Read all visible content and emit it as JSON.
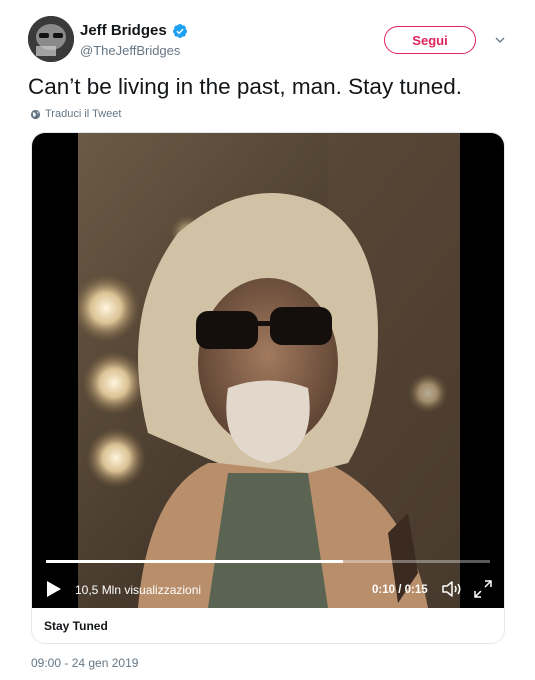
{
  "author": {
    "name": "Jeff Bridges",
    "handle": "@TheJeffBridges",
    "verified": true
  },
  "follow_button": {
    "label": "Segui"
  },
  "tweet": {
    "text": "Can’t be living in the past, man. Stay tuned.",
    "translate_label": "Traduci il Tweet",
    "timestamp": "09:00 - 24 gen 2019"
  },
  "video": {
    "views_label": "10,5 Mln visualizzazioni",
    "time_label": "0:10 / 0:15",
    "progress": 0.67
  },
  "card": {
    "title": "Stay Tuned"
  },
  "colors": {
    "follow_accent": "#e0245e",
    "verified_blue": "#1da1f2",
    "secondary_text": "#657786"
  },
  "icons": [
    "verified-badge-icon",
    "chevron-down-icon",
    "globe-icon",
    "play-icon",
    "volume-icon",
    "fullscreen-icon"
  ]
}
